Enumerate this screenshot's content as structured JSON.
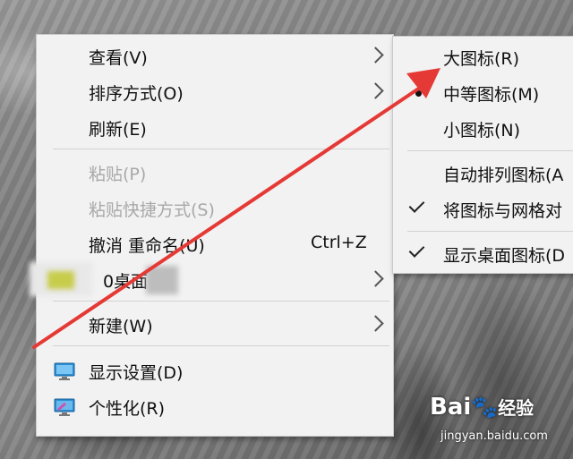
{
  "context_menu": {
    "items": [
      {
        "label": "查看(V)"
      },
      {
        "label": "排序方式(O)"
      },
      {
        "label": "刷新(E)"
      },
      {
        "label": "粘贴(P)"
      },
      {
        "label": "粘贴快捷方式(S)"
      },
      {
        "label": "撤消 重命名(U)",
        "shortcut": "Ctrl+Z"
      },
      {
        "label": "0桌面"
      },
      {
        "label": "新建(W)"
      },
      {
        "label": "显示设置(D)",
        "icon": "display-settings-icon"
      },
      {
        "label": "个性化(R)",
        "icon": "personalize-icon"
      }
    ]
  },
  "view_submenu": {
    "items": [
      {
        "label": "大图标(R)"
      },
      {
        "label": "中等图标(M)",
        "selected": true
      },
      {
        "label": "小图标(N)"
      },
      {
        "label": "自动排列图标(A"
      },
      {
        "label": "将图标与网格对",
        "checked": true
      },
      {
        "label": "显示桌面图标(D",
        "checked": true
      }
    ]
  },
  "annotation": {
    "arrow_color": "#e53935"
  },
  "watermark": {
    "brand": "Bai",
    "brand_suffix": "经验",
    "url": "jingyan.baidu.com"
  }
}
